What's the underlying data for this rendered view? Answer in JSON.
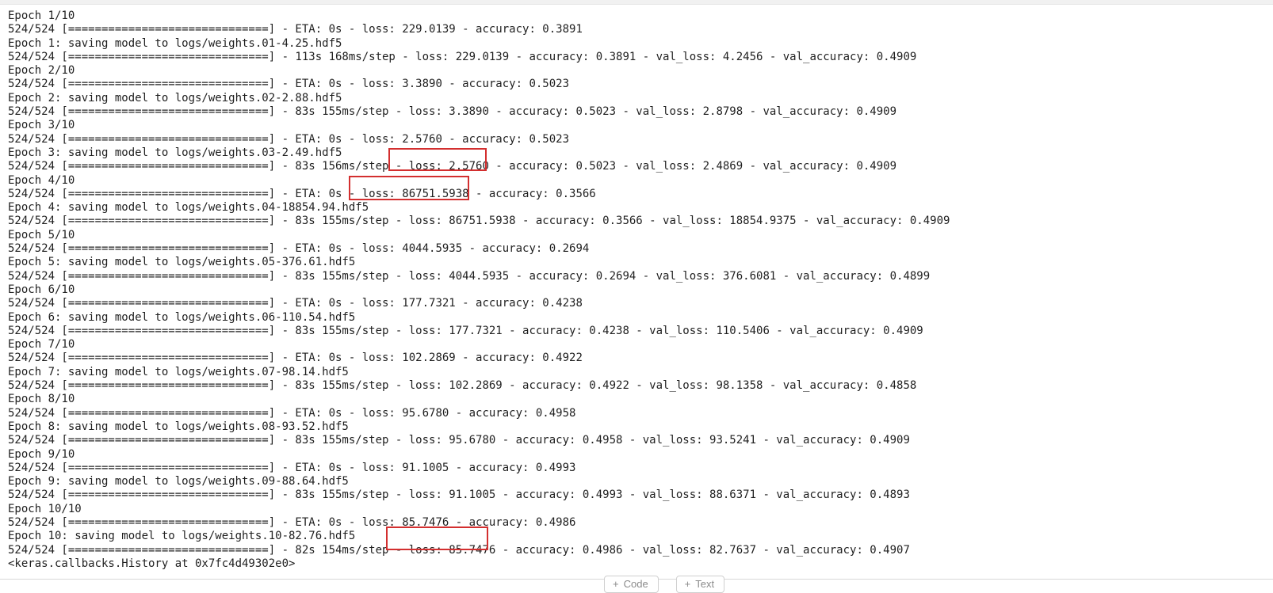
{
  "output_lines": [
    "Epoch 1/10",
    "524/524 [==============================] - ETA: 0s - loss: 229.0139 - accuracy: 0.3891",
    "Epoch 1: saving model to logs/weights.01-4.25.hdf5",
    "524/524 [==============================] - 113s 168ms/step - loss: 229.0139 - accuracy: 0.3891 - val_loss: 4.2456 - val_accuracy: 0.4909",
    "Epoch 2/10",
    "524/524 [==============================] - ETA: 0s - loss: 3.3890 - accuracy: 0.5023",
    "Epoch 2: saving model to logs/weights.02-2.88.hdf5",
    "524/524 [==============================] - 83s 155ms/step - loss: 3.3890 - accuracy: 0.5023 - val_loss: 2.8798 - val_accuracy: 0.4909",
    "Epoch 3/10",
    "524/524 [==============================] - ETA: 0s - loss: 2.5760 - accuracy: 0.5023",
    "Epoch 3: saving model to logs/weights.03-2.49.hdf5",
    "524/524 [==============================] - 83s 156ms/step - loss: 2.5760 - accuracy: 0.5023 - val_loss: 2.4869 - val_accuracy: 0.4909",
    "Epoch 4/10",
    "524/524 [==============================] - ETA: 0s - loss: 86751.5938 - accuracy: 0.3566",
    "Epoch 4: saving model to logs/weights.04-18854.94.hdf5",
    "524/524 [==============================] - 83s 155ms/step - loss: 86751.5938 - accuracy: 0.3566 - val_loss: 18854.9375 - val_accuracy: 0.4909",
    "Epoch 5/10",
    "524/524 [==============================] - ETA: 0s - loss: 4044.5935 - accuracy: 0.2694",
    "Epoch 5: saving model to logs/weights.05-376.61.hdf5",
    "524/524 [==============================] - 83s 155ms/step - loss: 4044.5935 - accuracy: 0.2694 - val_loss: 376.6081 - val_accuracy: 0.4899",
    "Epoch 6/10",
    "524/524 [==============================] - ETA: 0s - loss: 177.7321 - accuracy: 0.4238",
    "Epoch 6: saving model to logs/weights.06-110.54.hdf5",
    "524/524 [==============================] - 83s 155ms/step - loss: 177.7321 - accuracy: 0.4238 - val_loss: 110.5406 - val_accuracy: 0.4909",
    "Epoch 7/10",
    "524/524 [==============================] - ETA: 0s - loss: 102.2869 - accuracy: 0.4922",
    "Epoch 7: saving model to logs/weights.07-98.14.hdf5",
    "524/524 [==============================] - 83s 155ms/step - loss: 102.2869 - accuracy: 0.4922 - val_loss: 98.1358 - val_accuracy: 0.4858",
    "Epoch 8/10",
    "524/524 [==============================] - ETA: 0s - loss: 95.6780 - accuracy: 0.4958",
    "Epoch 8: saving model to logs/weights.08-93.52.hdf5",
    "524/524 [==============================] - 83s 155ms/step - loss: 95.6780 - accuracy: 0.4958 - val_loss: 93.5241 - val_accuracy: 0.4909",
    "Epoch 9/10",
    "524/524 [==============================] - ETA: 0s - loss: 91.1005 - accuracy: 0.4993",
    "Epoch 9: saving model to logs/weights.09-88.64.hdf5",
    "524/524 [==============================] - 83s 155ms/step - loss: 91.1005 - accuracy: 0.4993 - val_loss: 88.6371 - val_accuracy: 0.4893",
    "Epoch 10/10",
    "524/524 [==============================] - ETA: 0s - loss: 85.7476 - accuracy: 0.4986",
    "Epoch 10: saving model to logs/weights.10-82.76.hdf5",
    "524/524 [==============================] - 82s 154ms/step - loss: 85.7476 - accuracy: 0.4986 - val_loss: 82.7637 - val_accuracy: 0.4907",
    "<keras.callbacks.History at 0x7fc4d49302e0>"
  ],
  "add_bar": {
    "code_label": "Code",
    "text_label": "Text",
    "icon": "plus-icon"
  },
  "highlight_color": "#d32f2f"
}
